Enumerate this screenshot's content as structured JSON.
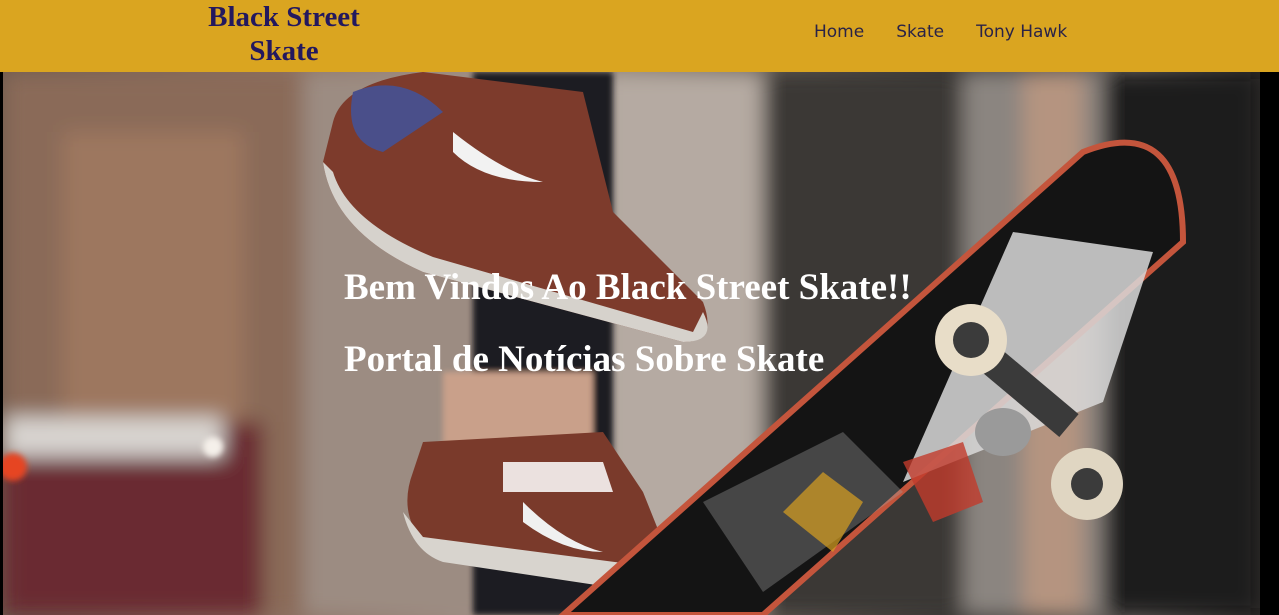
{
  "header": {
    "logo": "Black Street Skate",
    "nav": [
      {
        "label": "Home"
      },
      {
        "label": "Skate"
      },
      {
        "label": "Tony Hawk"
      }
    ]
  },
  "hero": {
    "title": "Bem Vindos Ao Black Street Skate!!",
    "subtitle": "Portal de Notícias Sobre Skate",
    "image": "skateboard-trick-photo"
  },
  "colors": {
    "header_bg": "#DAA520",
    "logo_text": "#23185e",
    "nav_text": "#2a2347",
    "hero_text": "#ffffff"
  }
}
